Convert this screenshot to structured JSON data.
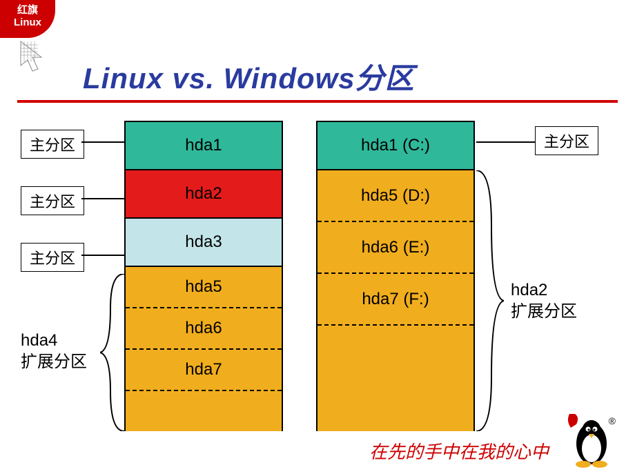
{
  "logo": {
    "line1": "红旗",
    "line2": "Linux"
  },
  "title": "Linux vs. Windows分区",
  "labels": {
    "primary": "主分区",
    "linux_ext": {
      "name": "hda4",
      "desc": "扩展分区"
    },
    "win_ext": {
      "name": "hda2",
      "desc": "扩展分区"
    }
  },
  "linux_disk": {
    "p1": "hda1",
    "p2": "hda2",
    "p3": "hda3",
    "ext": [
      "hda5",
      "hda6",
      "hda7"
    ]
  },
  "windows_disk": {
    "p1": "hda1 (C:)",
    "ext": [
      "hda5 (D:)",
      "hda6 (E:)",
      "hda7 (F:)"
    ]
  },
  "footer": "在先的手中在我的心中",
  "reg": "®"
}
